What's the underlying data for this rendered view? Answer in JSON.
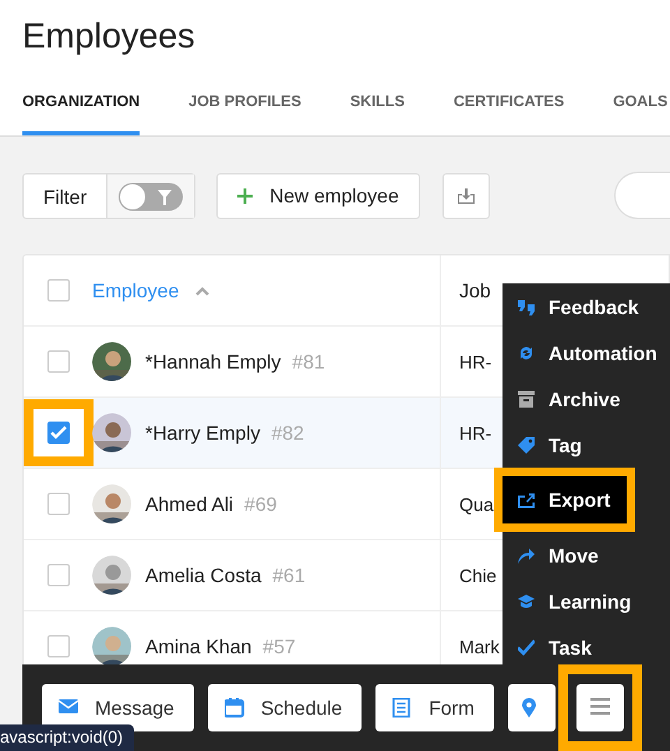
{
  "page": {
    "title": "Employees"
  },
  "tabs": [
    {
      "label": "ORGANIZATION",
      "selected": true
    },
    {
      "label": "JOB PROFILES",
      "selected": false
    },
    {
      "label": "SKILLS",
      "selected": false
    },
    {
      "label": "CERTIFICATES",
      "selected": false
    },
    {
      "label": "GOALS",
      "selected": false
    }
  ],
  "toolbar": {
    "filter_label": "Filter",
    "filter_on": false,
    "new_button": "New employee"
  },
  "table": {
    "all_checked": false,
    "columns": [
      {
        "label": "Employee",
        "sorted": true
      },
      {
        "label": "Job",
        "sorted": false
      }
    ],
    "rows": [
      {
        "name": "*Hannah Emply",
        "number": "#81",
        "job": "HR-",
        "checked": false,
        "highlighted": false
      },
      {
        "name": "*Harry Emply",
        "number": "#82",
        "job": "HR-",
        "checked": true,
        "highlighted": true
      },
      {
        "name": "Ahmed Ali",
        "number": "#69",
        "job": "Qua",
        "checked": false,
        "highlighted": false
      },
      {
        "name": "Amelia Costa",
        "number": "#61",
        "job": "Chie",
        "checked": false,
        "highlighted": false
      },
      {
        "name": "Amina Khan",
        "number": "#57",
        "job": "Mark",
        "checked": false,
        "highlighted": false
      }
    ]
  },
  "menu": {
    "items": [
      {
        "kind": "feedback",
        "label": "Feedback",
        "selected": false,
        "highlighted": false
      },
      {
        "kind": "automation",
        "label": "Automation",
        "selected": false,
        "highlighted": false
      },
      {
        "kind": "archive",
        "label": "Archive",
        "selected": false,
        "highlighted": false
      },
      {
        "kind": "tag",
        "label": "Tag",
        "selected": false,
        "highlighted": false
      },
      {
        "kind": "export",
        "label": "Export",
        "selected": true,
        "highlighted": true
      },
      {
        "kind": "move",
        "label": "Move",
        "selected": false,
        "highlighted": false
      },
      {
        "kind": "learning",
        "label": "Learning",
        "selected": false,
        "highlighted": false
      },
      {
        "kind": "task",
        "label": "Task",
        "selected": false,
        "highlighted": false
      }
    ]
  },
  "action_bar": {
    "buttons": [
      {
        "kind": "message",
        "label": "Message"
      },
      {
        "kind": "schedule",
        "label": "Schedule"
      },
      {
        "kind": "form",
        "label": "Form"
      },
      {
        "kind": "location"
      },
      {
        "kind": "more",
        "highlighted": true
      }
    ]
  },
  "status_bar": {
    "url": "avascript:void(0)"
  }
}
